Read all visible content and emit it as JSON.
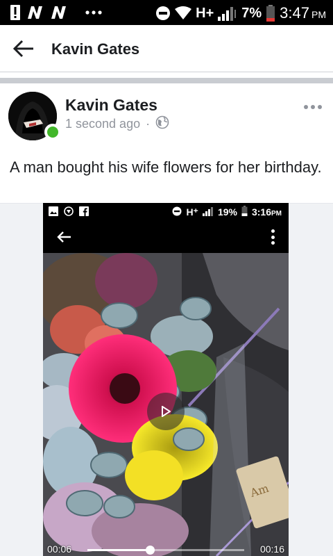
{
  "status_bar": {
    "battery": "7%",
    "network": "H+",
    "time": "3:47",
    "ampm": "PM",
    "left_icons": [
      "alert-icon",
      "notification-n-icon",
      "notification-n-icon",
      "more-dots-icon"
    ],
    "right_icons": [
      "do-not-disturb-icon",
      "wifi-icon",
      "signal-icon",
      "battery-low-icon"
    ]
  },
  "app_bar": {
    "title": "Kavin Gates"
  },
  "post": {
    "author": "Kavin Gates",
    "timestamp": "1 second ago",
    "separator": "·",
    "privacy_icon": "globe-icon",
    "text": "A man bought his wife flowers for her birthday.",
    "online": true
  },
  "video": {
    "inner_status": {
      "network": "H⁺",
      "battery": "19%",
      "time": "3:16",
      "ampm": "PM"
    },
    "elapsed": "00:06",
    "duration": "00:16",
    "progress": 0.4
  },
  "colors": {
    "online": "#42b72a",
    "meta_gray": "#90949c",
    "text": "#1c1e21",
    "divider": "#c9ccd1"
  }
}
